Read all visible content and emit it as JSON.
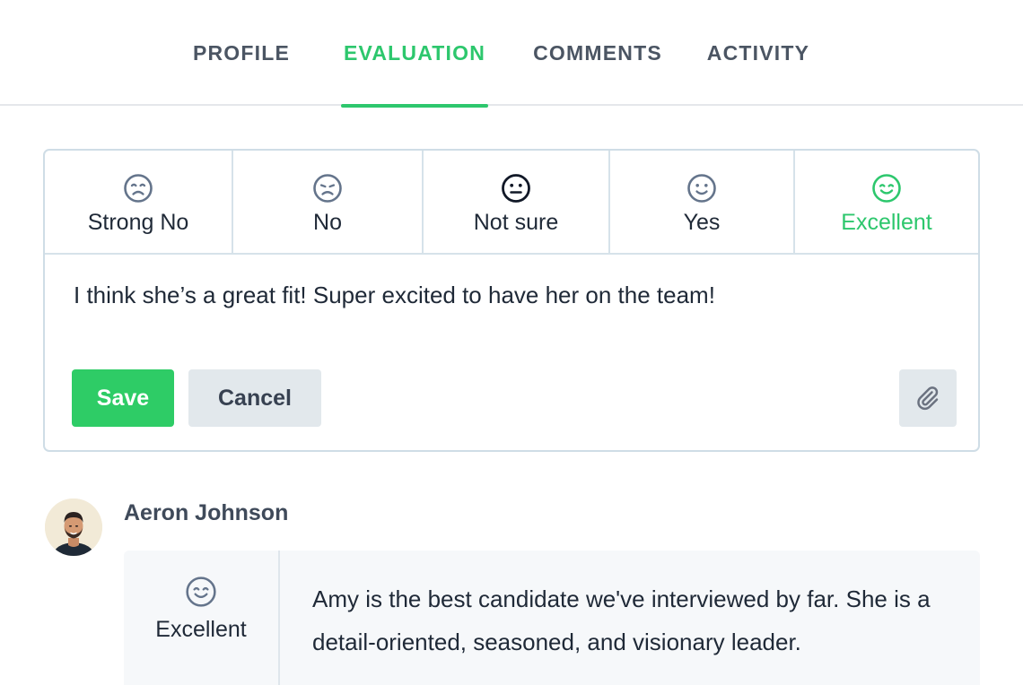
{
  "tabs": [
    {
      "label": "PROFILE"
    },
    {
      "label": "EVALUATION",
      "active": true
    },
    {
      "label": "COMMENTS"
    },
    {
      "label": "ACTIVITY"
    }
  ],
  "evaluation": {
    "ratings": [
      {
        "label": "Strong No",
        "icon": "strong-no-face-icon"
      },
      {
        "label": "No",
        "icon": "no-face-icon"
      },
      {
        "label": "Not sure",
        "icon": "neutral-face-icon"
      },
      {
        "label": "Yes",
        "icon": "yes-face-icon"
      },
      {
        "label": "Excellent",
        "icon": "excellent-face-icon",
        "selected": true
      }
    ],
    "comment_value": "I think she’s a great fit! Super excited to have her on the team!",
    "save_label": "Save",
    "cancel_label": "Cancel",
    "attach_icon": "paperclip-icon"
  },
  "review": {
    "author": "Aeron Johnson",
    "rating_label": "Excellent",
    "rating_icon": "excellent-face-icon",
    "text": "Amy is the best candidate we've interviewed by far. She is a detail-oriented, seasoned, and visionary leader."
  },
  "colors": {
    "accent": "#2dc76d",
    "border": "#cfdde6",
    "muted_text": "#4b5563",
    "icon_gray": "#64748b",
    "button_gray": "#e2e8ec"
  }
}
